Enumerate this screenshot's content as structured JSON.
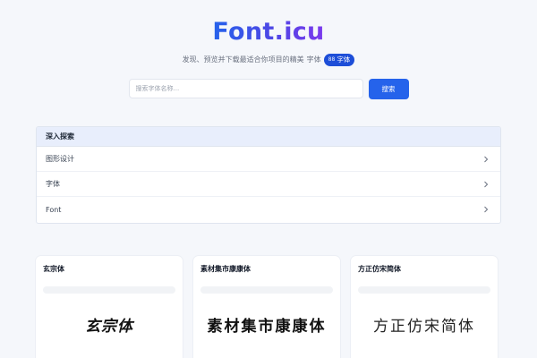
{
  "header": {
    "logo": "Font.icu",
    "tagline": "发现、预览并下载最适合你项目的精美",
    "tagline_suffix": "字体",
    "badge_count": "88",
    "badge_label": "字体"
  },
  "search": {
    "placeholder": "搜索字体名称...",
    "value": "",
    "button_label": "搜索"
  },
  "explore": {
    "title": "深入探索",
    "items": [
      {
        "label": "图形设计",
        "icon": "chevron-right-icon"
      },
      {
        "label": "字体",
        "icon": "chevron-right-icon"
      },
      {
        "label": "Font",
        "icon": "chevron-right-icon"
      }
    ]
  },
  "cards": [
    {
      "title": "玄宗体",
      "preview": "玄宗体"
    },
    {
      "title": "素材集市康康体",
      "preview": "素材集市康康体"
    },
    {
      "title": "方正仿宋简体",
      "preview": "方正仿宋简体"
    }
  ],
  "colors": {
    "accent": "#2563eb",
    "background": "#f5f7fb",
    "explore_header": "#e8eefc"
  }
}
